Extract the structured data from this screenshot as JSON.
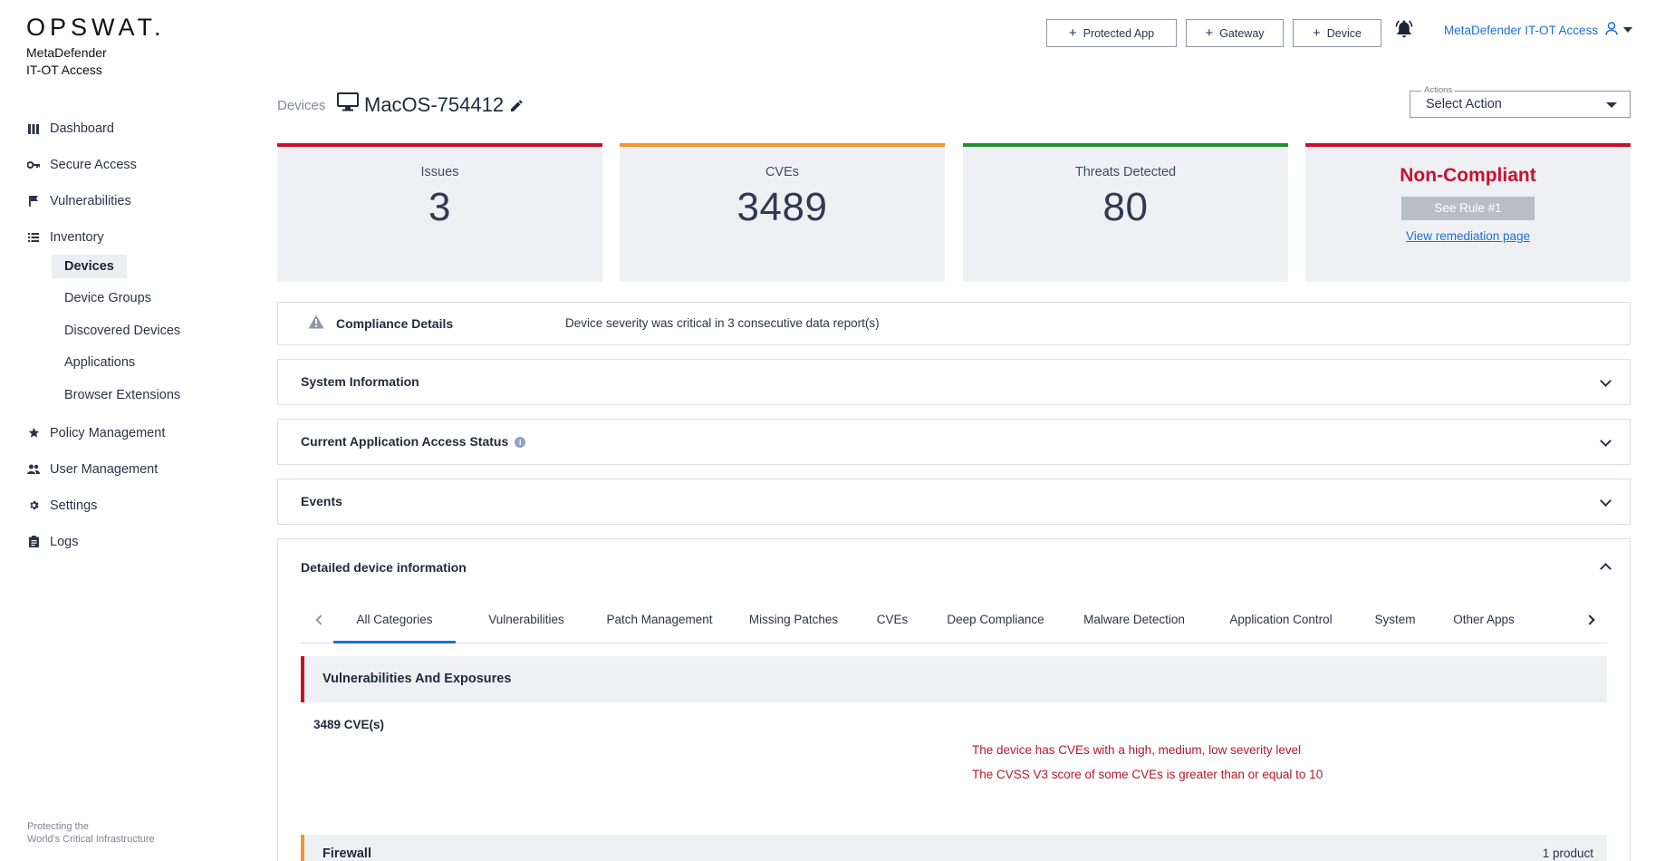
{
  "brand": {
    "logo": "OPSWAT.",
    "product_line1": "MetaDefender",
    "product_line2": "IT-OT Access",
    "tagline_line1": "Protecting the",
    "tagline_line2": "World's Critical Infrastructure"
  },
  "sidebar": {
    "items": [
      {
        "label": "Dashboard",
        "icon": "bar-chart-icon"
      },
      {
        "label": "Secure Access",
        "icon": "key-icon"
      },
      {
        "label": "Vulnerabilities",
        "icon": "flag-icon"
      },
      {
        "label": "Inventory",
        "icon": "list-icon"
      },
      {
        "label": "Policy Management",
        "icon": "star-icon"
      },
      {
        "label": "User Management",
        "icon": "users-icon"
      },
      {
        "label": "Settings",
        "icon": "gear-icon"
      },
      {
        "label": "Logs",
        "icon": "clipboard-icon"
      }
    ],
    "inventory_sub": [
      {
        "label": "Devices",
        "active": true
      },
      {
        "label": "Device Groups"
      },
      {
        "label": "Discovered Devices"
      },
      {
        "label": "Applications"
      },
      {
        "label": "Browser Extensions"
      }
    ]
  },
  "header": {
    "buttons": [
      "Protected App",
      "Gateway",
      "Device"
    ],
    "user_label": "MetaDefender IT-OT Access"
  },
  "page": {
    "breadcrumb": "Devices",
    "device_name": "MacOS-754412",
    "actions_legend": "Actions",
    "actions_value": "Select Action"
  },
  "cards": {
    "issues": {
      "label": "Issues",
      "value": "3",
      "color": "#c8102e"
    },
    "cves": {
      "label": "CVEs",
      "value": "3489",
      "color": "#f0962e"
    },
    "threats": {
      "label": "Threats Detected",
      "value": "80",
      "color": "#1f8f2e"
    },
    "compliance": {
      "title": "Non-Compliant",
      "button": "See Rule #1",
      "link": "View remediation page",
      "color": "#c8102e"
    }
  },
  "compliance_details": {
    "title": "Compliance Details",
    "message": "Device severity was critical in 3 consecutive data report(s)"
  },
  "panels": {
    "system_info": "System Information",
    "app_access": "Current Application Access Status",
    "events": "Events",
    "detailed": "Detailed device information"
  },
  "tabs": [
    "All Categories",
    "Vulnerabilities",
    "Patch Management",
    "Missing Patches",
    "CVEs",
    "Deep Compliance",
    "Malware Detection",
    "Application Control",
    "System",
    "Other Apps"
  ],
  "vuln_section": {
    "title": "Vulnerabilities And Exposures",
    "count": "3489 CVE(s)",
    "notes": [
      "The device has CVEs with a high, medium, low severity level",
      "The CVSS V3 score of some CVEs is greater than or equal to 10"
    ]
  },
  "firewall_section": {
    "title": "Firewall",
    "count": "1 product"
  }
}
